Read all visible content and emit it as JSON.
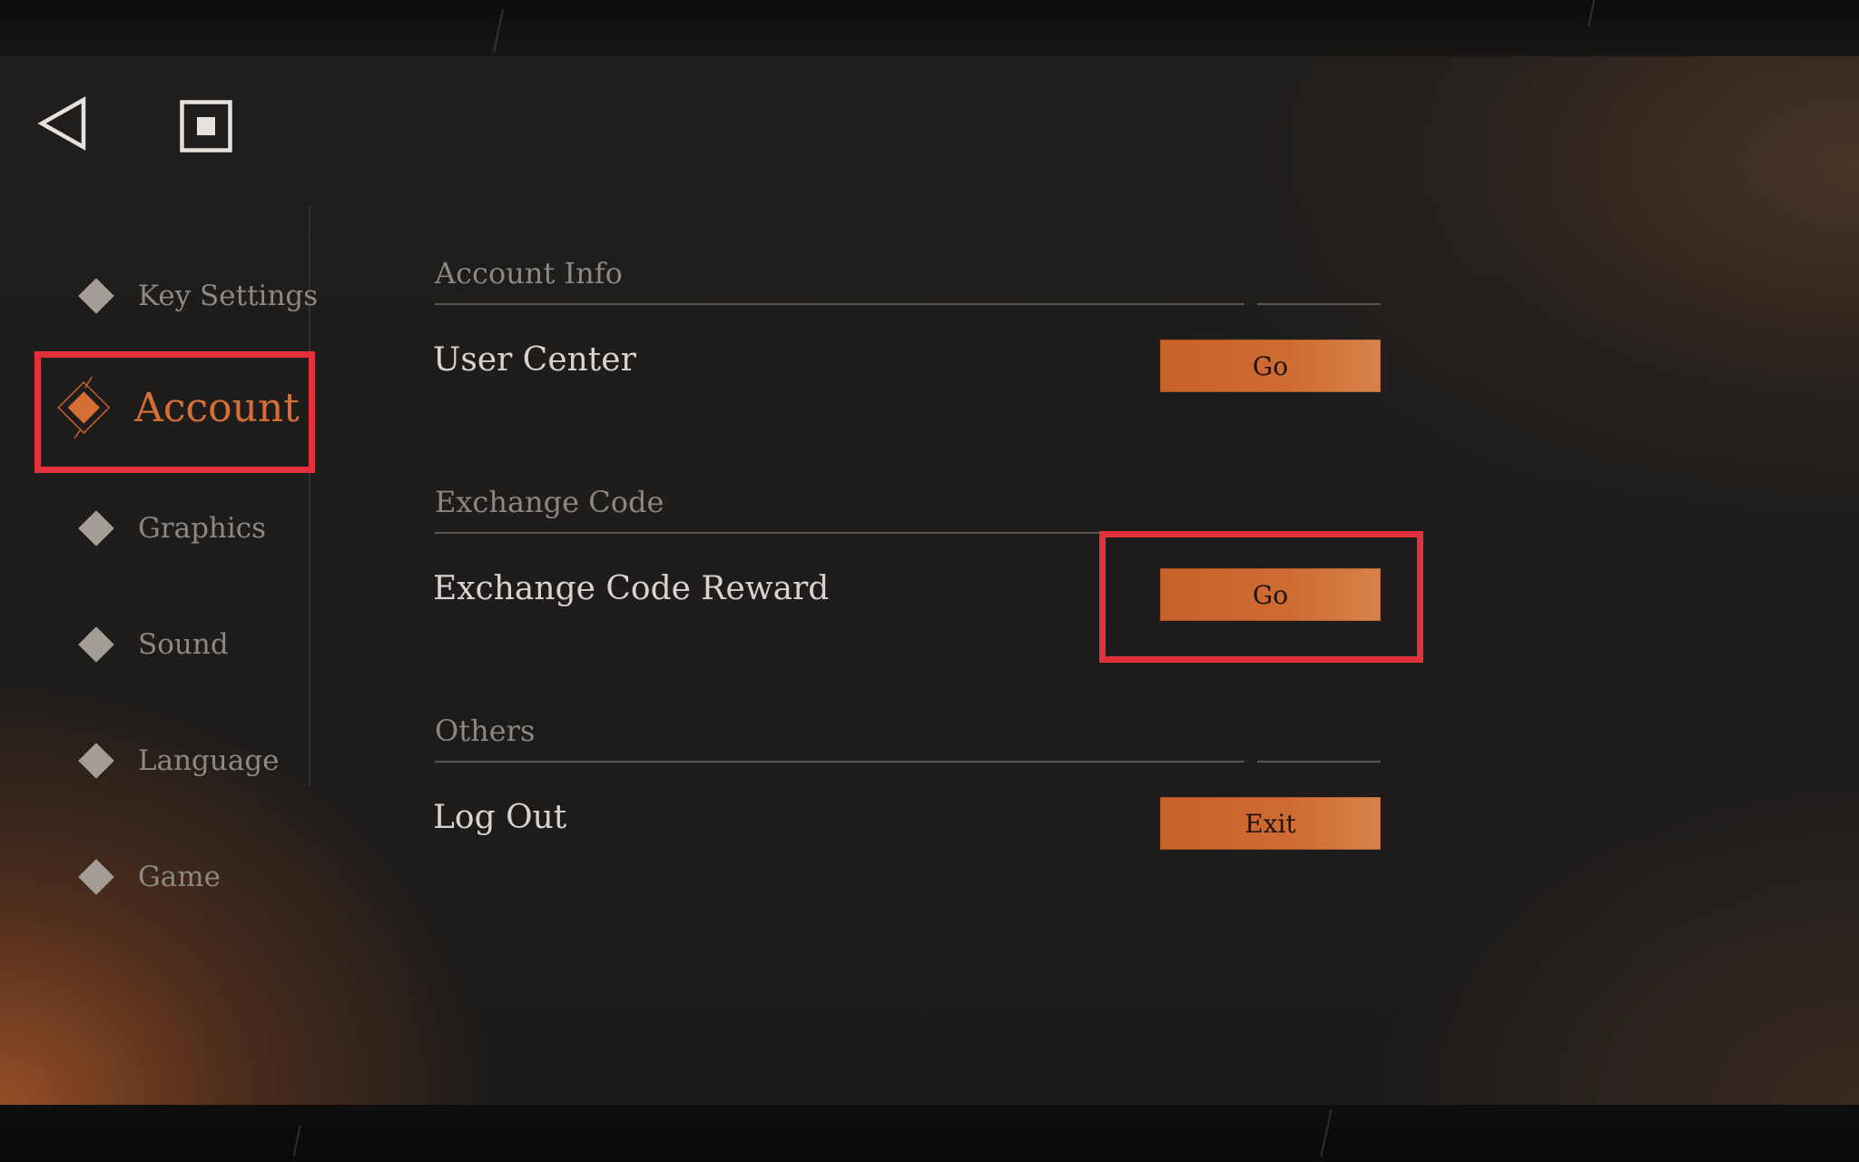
{
  "nav": {
    "back_icon": "back-triangle-icon",
    "home_icon": "square-stop-icon"
  },
  "sidebar": {
    "items": [
      {
        "label": "Key Settings",
        "active": false
      },
      {
        "label": "Account",
        "active": true
      },
      {
        "label": "Graphics",
        "active": false
      },
      {
        "label": "Sound",
        "active": false
      },
      {
        "label": "Language",
        "active": false
      },
      {
        "label": "Game",
        "active": false
      }
    ]
  },
  "sections": [
    {
      "title": "Account Info",
      "rows": [
        {
          "label": "User Center",
          "button": "Go"
        }
      ]
    },
    {
      "title": "Exchange Code",
      "rows": [
        {
          "label": "Exchange Code Reward",
          "button": "Go"
        }
      ]
    },
    {
      "title": "Others",
      "rows": [
        {
          "label": "Log Out",
          "button": "Exit"
        }
      ]
    }
  ],
  "colors": {
    "accent": "#cf6c33",
    "highlight": "#e2313a",
    "background": "#1f1e1d"
  }
}
